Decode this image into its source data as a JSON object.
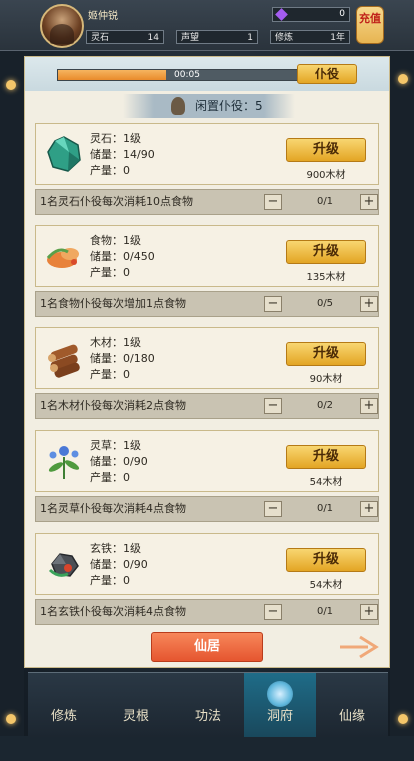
{
  "player": {
    "name": "姬仲锐",
    "gems": "0",
    "recharge_label": "充值",
    "stats": [
      {
        "label": "灵石",
        "value": "14"
      },
      {
        "label": "声望",
        "value": "1"
      },
      {
        "label": "修炼",
        "value": "1年"
      }
    ]
  },
  "progress": {
    "time": "00:05",
    "task_button": "仆役",
    "fill_fraction": 0.42
  },
  "idle_servants": "闲置仆役：5",
  "resources": [
    {
      "name_line": "灵石：1级",
      "storage_line": "储量：14/90",
      "output_line": "产量：0",
      "upgrade_label": "升级",
      "cost": "900木材",
      "footer": "1名灵石仆役每次消耗10点食物",
      "count": "0/1",
      "icon": "spirit-stone-icon"
    },
    {
      "name_line": "食物：1级",
      "storage_line": "储量：0/450",
      "output_line": "产量：0",
      "upgrade_label": "升级",
      "cost": "135木材",
      "footer": "1名食物仆役每次增加1点食物",
      "count": "0/5",
      "icon": "food-icon"
    },
    {
      "name_line": "木材：1级",
      "storage_line": "储量：0/180",
      "output_line": "产量：0",
      "upgrade_label": "升级",
      "cost": "90木材",
      "footer": "1名木材仆役每次消耗2点食物",
      "count": "0/2",
      "icon": "wood-icon"
    },
    {
      "name_line": "灵草：1级",
      "storage_line": "储量：0/90",
      "output_line": "产量：0",
      "upgrade_label": "升级",
      "cost": "54木材",
      "footer": "1名灵草仆役每次消耗4点食物",
      "count": "0/1",
      "icon": "herb-icon"
    },
    {
      "name_line": "玄铁：1级",
      "storage_line": "储量：0/90",
      "output_line": "产量：0",
      "upgrade_label": "升级",
      "cost": "54木材",
      "footer": "1名玄铁仆役每次消耗4点食物",
      "count": "0/1",
      "icon": "iron-icon"
    }
  ],
  "home_button": "仙居",
  "nav": [
    {
      "label": "修炼"
    },
    {
      "label": "灵根"
    },
    {
      "label": "功法"
    },
    {
      "label": "洞府",
      "active": true
    },
    {
      "label": "仙缘"
    }
  ],
  "colors": {
    "accent_gold": "#e3a524",
    "accent_orange": "#e5552f",
    "nav_active": "#1f6c88"
  }
}
